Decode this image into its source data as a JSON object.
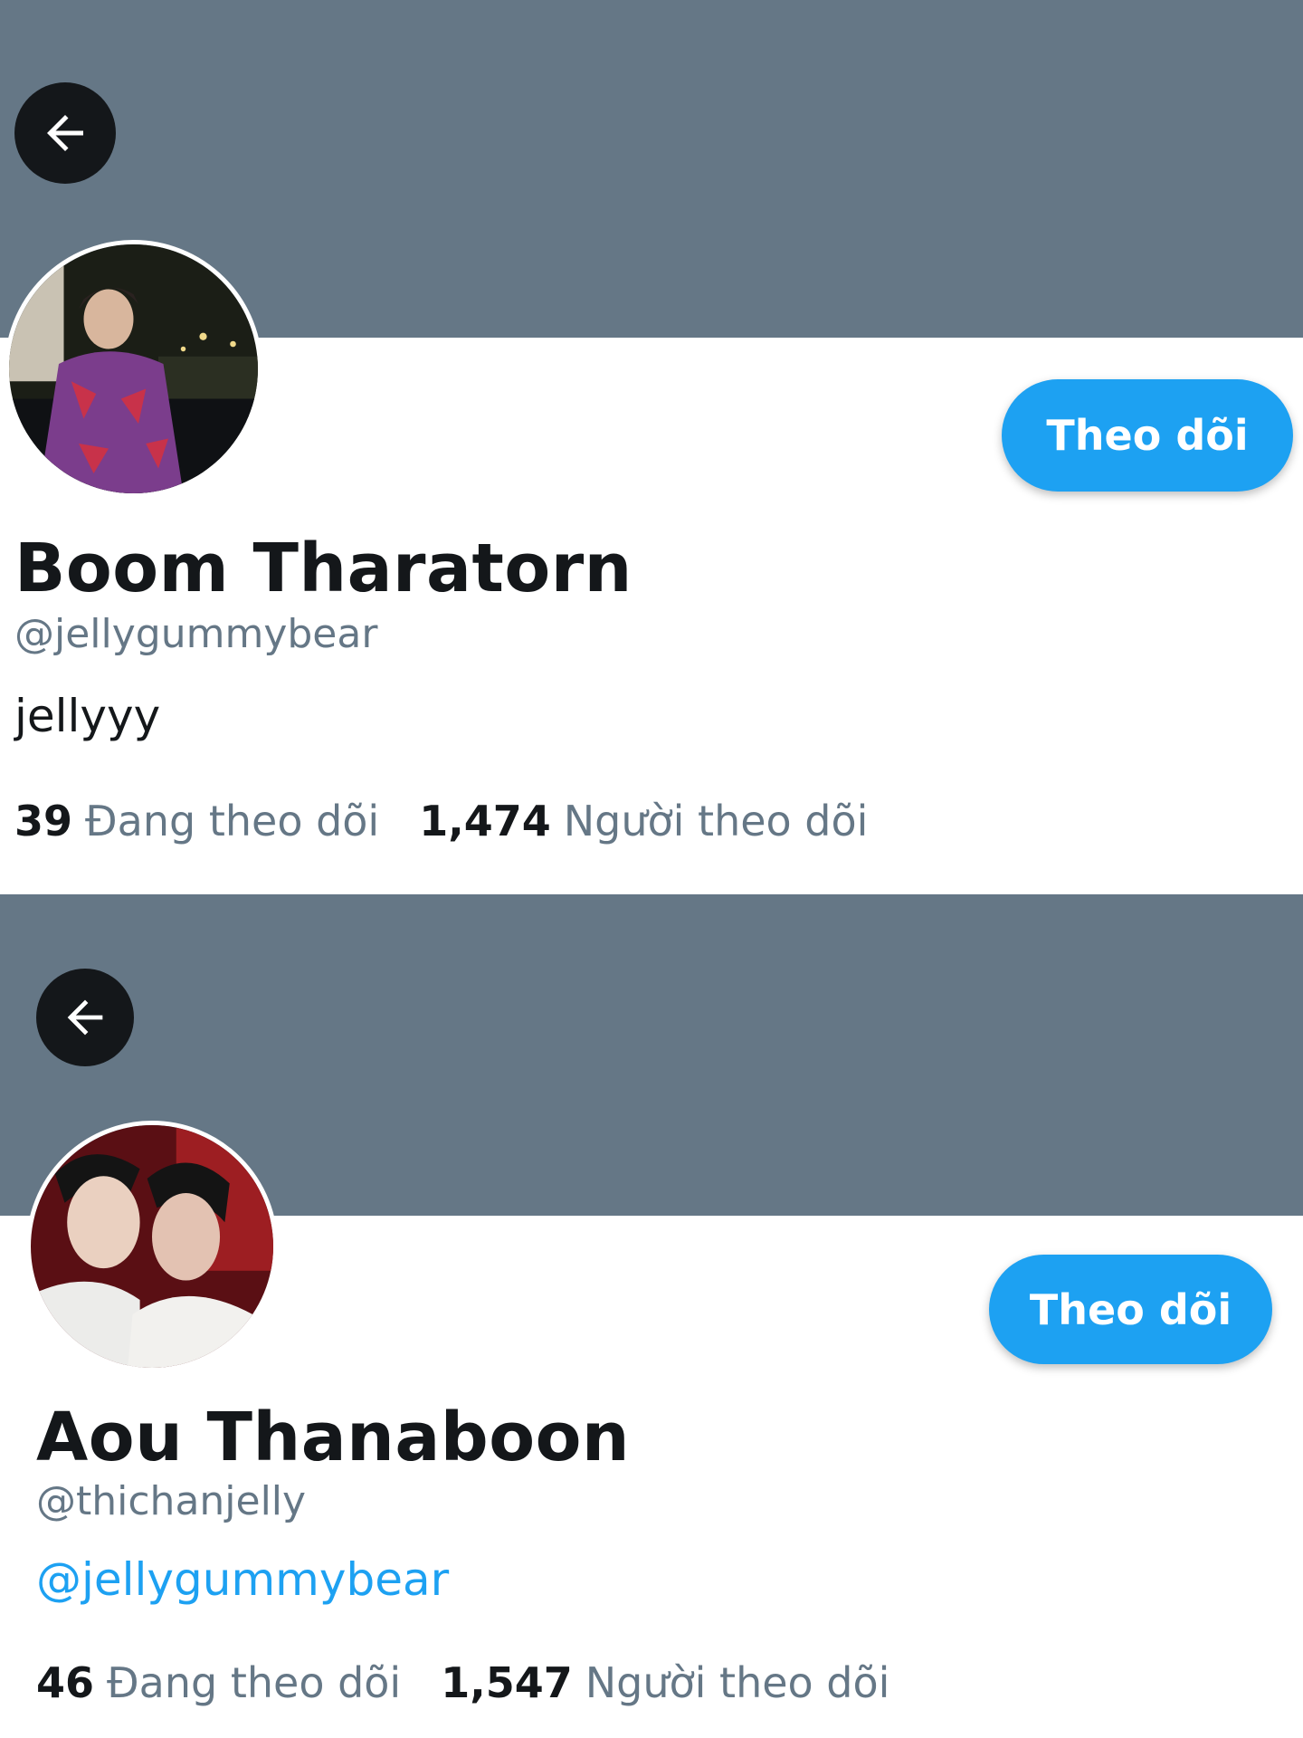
{
  "profiles": [
    {
      "display_name": "Boom Tharatorn",
      "handle": "@jellygummybear",
      "bio": "jellyyy",
      "following_count": "39",
      "following_label": "Đang theo dõi",
      "followers_count": "1,474",
      "followers_label": "Người theo dõi",
      "follow_button": "Theo dõi"
    },
    {
      "display_name": "Aou Thanaboon",
      "handle": "@thichanjelly",
      "bio": "@jellygummybear",
      "following_count": "46",
      "following_label": "Đang theo dõi",
      "followers_count": "1,547",
      "followers_label": "Người theo dõi",
      "follow_button": "Theo dõi"
    }
  ],
  "icons": {
    "back": "arrow-left-icon"
  },
  "colors": {
    "banner": "#657786",
    "accent": "#1da1f2",
    "text": "#14171a",
    "muted": "#657786"
  }
}
